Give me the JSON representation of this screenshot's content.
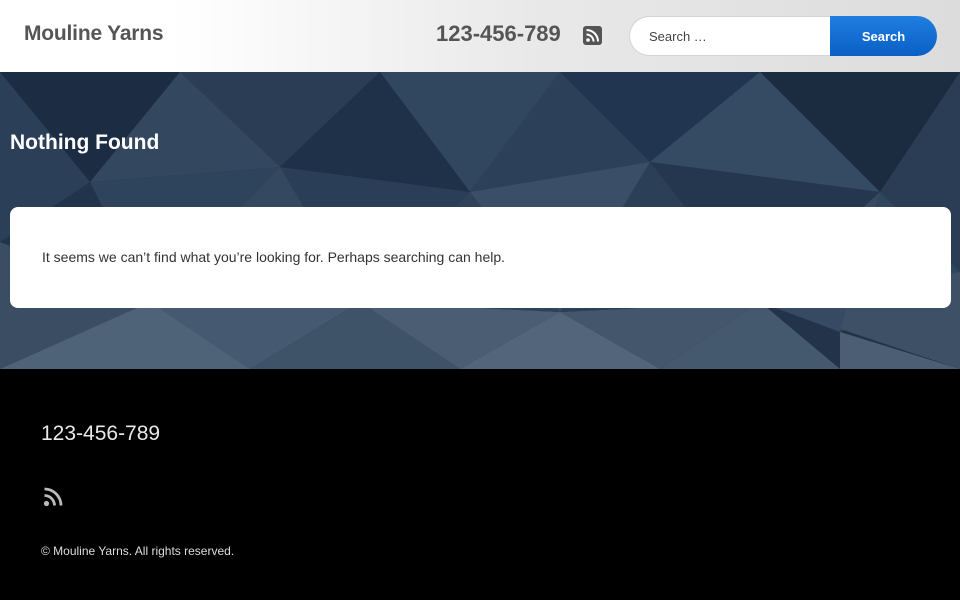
{
  "header": {
    "site_title": "Mouline Yarns",
    "phone": "123-456-789",
    "rss_icon": "rss-icon",
    "search": {
      "placeholder": "Search …",
      "button_label": "Search"
    }
  },
  "main": {
    "page_title": "Nothing Found",
    "message": "It seems we can’t find what you’re looking for. Perhaps searching can help."
  },
  "footer": {
    "phone": "123-456-789",
    "rss_icon": "rss-icon",
    "copyright": "© Mouline Yarns. All rights reserved."
  },
  "colors": {
    "accent": "#0a6fd6",
    "hero_bg": "#23344a",
    "footer_bg": "#000000"
  }
}
